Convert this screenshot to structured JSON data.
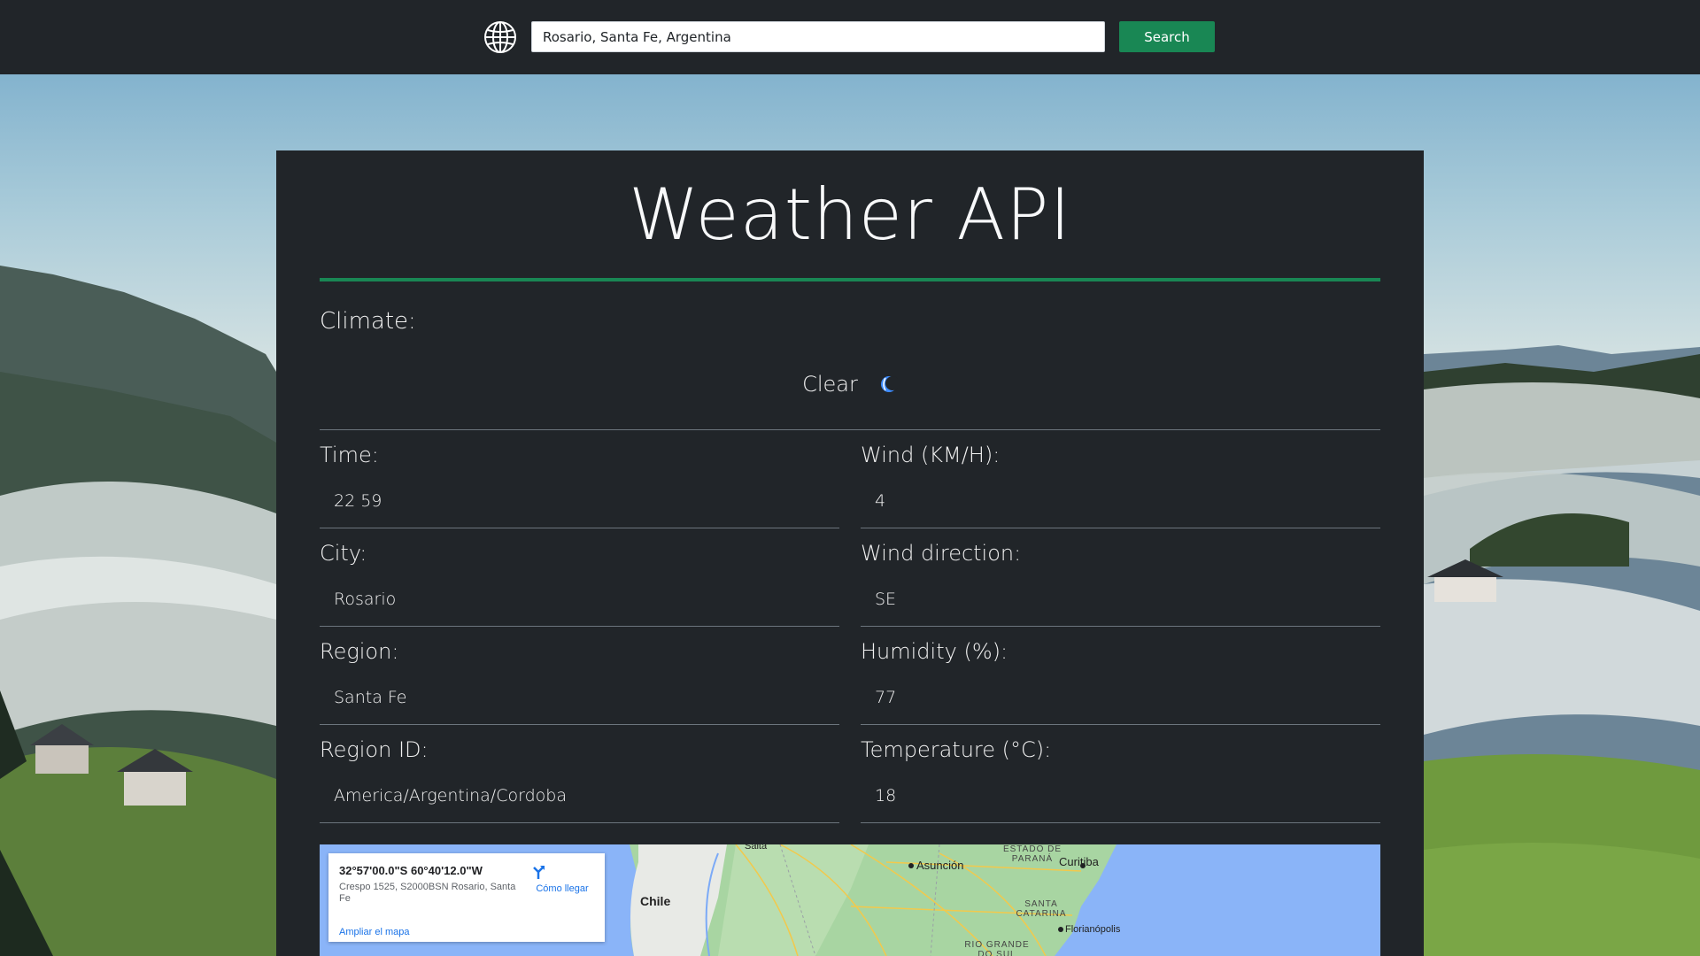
{
  "search": {
    "value": "Rosario, Santa Fe, Argentina",
    "button_label": "Search"
  },
  "page": {
    "title": "Weather API"
  },
  "climate": {
    "label": "Climate:",
    "value": "Clear",
    "icon": "moon-icon"
  },
  "fields": {
    "time": {
      "label": "Time:",
      "value": "22 59"
    },
    "wind_kmh": {
      "label": "Wind (KM/H):",
      "value": "4"
    },
    "city": {
      "label": "City:",
      "value": "Rosario"
    },
    "wind_direction": {
      "label": "Wind direction:",
      "value": "SE"
    },
    "region": {
      "label": "Region:",
      "value": "Santa Fe"
    },
    "humidity": {
      "label": "Humidity (%):",
      "value": "77"
    },
    "region_id": {
      "label": "Region ID:",
      "value": "America/Argentina/Cordoba"
    },
    "temperature": {
      "label": "Temperature (°C):",
      "value": "18"
    }
  },
  "map": {
    "coordinates": "32°57'00.0\"S 60°40'12.0\"W",
    "address": "Crespo 1525, S2000BSN Rosario, Santa Fe",
    "directions_label": "Cómo llegar",
    "enlarge_label": "Ampliar el mapa",
    "place_labels": {
      "chile": "Chile",
      "salta": "Salta",
      "asuncion": "Asunción",
      "estado_parana": "ESTADO DE PARANÁ",
      "curitiba": "Curitiba",
      "santa_catarina": "SANTA CATARINA",
      "florianopolis": "Florianópolis",
      "rio_grande": "RIO GRANDE DO SUL"
    }
  },
  "colors": {
    "dark": "#212529",
    "accent_green": "#198754",
    "map_water": "#8ab4f8",
    "map_land": "#a8d5a2",
    "link_blue": "#1a73e8"
  }
}
